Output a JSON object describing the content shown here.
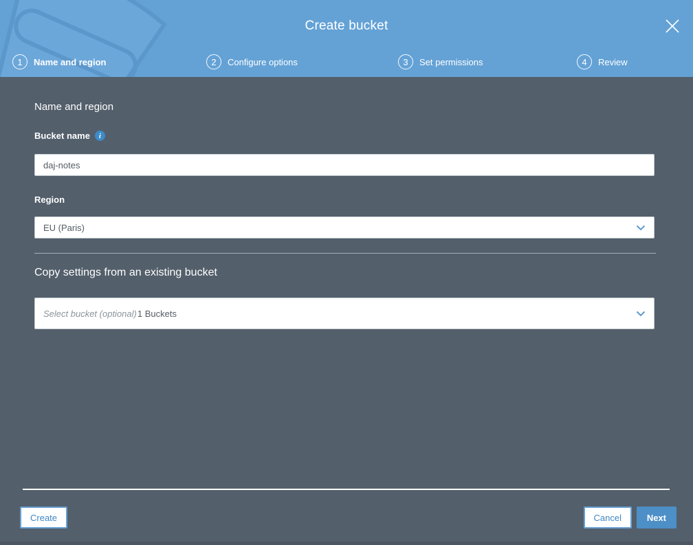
{
  "modal": {
    "title": "Create bucket"
  },
  "steps": [
    {
      "number": "1",
      "label": "Name and region"
    },
    {
      "number": "2",
      "label": "Configure options"
    },
    {
      "number": "3",
      "label": "Set permissions"
    },
    {
      "number": "4",
      "label": "Review"
    }
  ],
  "form": {
    "section_title": "Name and region",
    "bucket_name_label": "Bucket name",
    "bucket_name_value": "daj-notes",
    "info_icon_glyph": "i",
    "region_label": "Region",
    "region_value": "EU (Paris)",
    "copy_settings_title": "Copy settings from an existing bucket",
    "bucket_select_placeholder": "Select bucket (optional)",
    "bucket_select_count": "1 Buckets"
  },
  "footer": {
    "create_label": "Create",
    "cancel_label": "Cancel",
    "next_label": "Next"
  },
  "colors": {
    "header_blue": "#64a2d6",
    "body_slate": "#535f6b",
    "accent_blue": "#4d8fc7",
    "link_blue": "#3f87c5"
  }
}
